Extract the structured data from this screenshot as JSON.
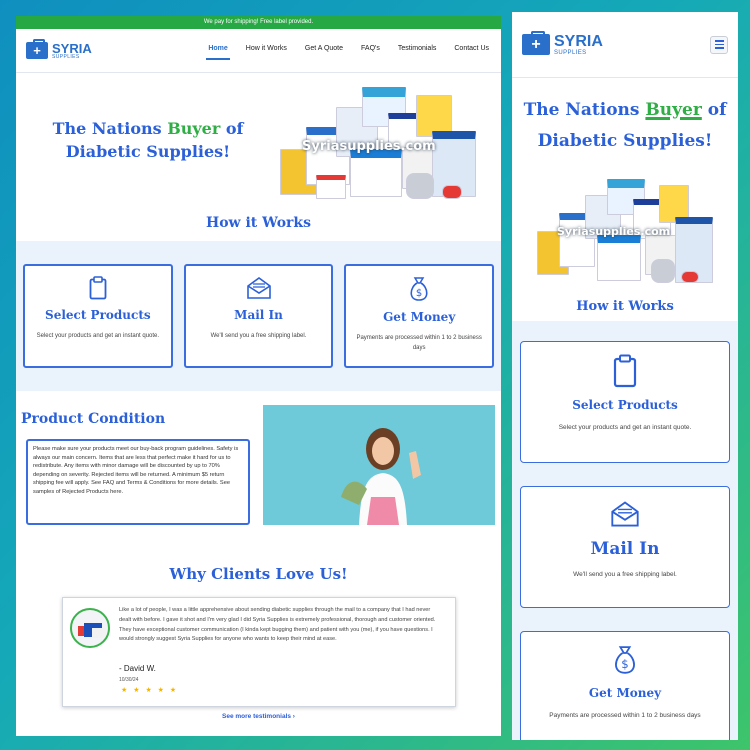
{
  "desktop": {
    "shipping_banner": "We pay for shipping! Free label provided.",
    "logo": {
      "name": "SYRIA",
      "tagline": "SUPPLIES"
    },
    "nav": [
      {
        "label": "Home",
        "active": true
      },
      {
        "label": "How it Works"
      },
      {
        "label": "Get A Quote"
      },
      {
        "label": "FAQ's"
      },
      {
        "label": "Testimonials"
      },
      {
        "label": "Contact Us"
      }
    ],
    "hero": {
      "headline_pre": "The Nations ",
      "headline_accent": "Buyer",
      "headline_post": " of Diabetic Supplies!",
      "image_watermark": "Syriasupplies.com"
    },
    "how_it_works": {
      "title": "How it Works",
      "steps": [
        {
          "icon": "clipboard-icon",
          "title": "Select Products",
          "text": "Select your products and get an instant quote."
        },
        {
          "icon": "envelope-icon",
          "title": "Mail In",
          "text": "We'll send you a free shipping label."
        },
        {
          "icon": "money-bag-icon",
          "title": "Get Money",
          "text": "Payments are processed within 1 to 2 business days"
        }
      ]
    },
    "product_condition": {
      "title": "Product Condition",
      "text": "Please make sure your products meet our buy-back program guidelines. Safety is always our main concern. Items that are less that perfect make it hard for us to redistribute. Any items with minor damage will be discounted by up to 70% depending on severity. Rejected items will be returned. A minimum $5 return shipping fee will apply. See FAQ and Terms & Conditions for more details. See samples of Rejected Products here."
    },
    "testimonials": {
      "title": "Why Clients Love Us!",
      "quote": "Like a lot of people, I was a little apprehensive about sending diabetic supplies through the mail to a company that I had never dealt with before. I gave it shot and I'm very glad I did Syria Supplies is extremely professional, thorough and customer oriented. They have exceptional customer communication (I kinda kept bugging them) and patient with you (me), if you have questions. I would strongly suggest Syria Supplies for anyone who wants to keep their mind at ease.",
      "author": "- David W.",
      "date": "10/30/24",
      "stars": "★ ★ ★ ★ ★",
      "rating": 5,
      "see_more": "See more testimonials  ›"
    }
  },
  "mobile": {
    "logo": {
      "name": "SYRIA",
      "tagline": "SUPPLIES"
    },
    "hero": {
      "headline_pre": "The Nations ",
      "headline_accent": "Buyer",
      "headline_post": " of Diabetic Supplies!",
      "image_watermark": "Syriasupplies.com"
    },
    "how_it_works": {
      "title": "How it Works",
      "steps": [
        {
          "icon": "clipboard-icon",
          "title": "Select Products",
          "text": "Select your products and get an instant quote."
        },
        {
          "icon": "envelope-icon",
          "title": "Mail In",
          "text": "We'll send you a free shipping label."
        },
        {
          "icon": "money-bag-icon",
          "title": "Get Money",
          "text": "Payments are processed within 1 to 2 business days"
        }
      ]
    }
  },
  "colors": {
    "brand_blue": "#2b60d8",
    "brand_green": "#2fae45",
    "banner_green": "#26a844",
    "band_bg": "#eaf2fb"
  }
}
